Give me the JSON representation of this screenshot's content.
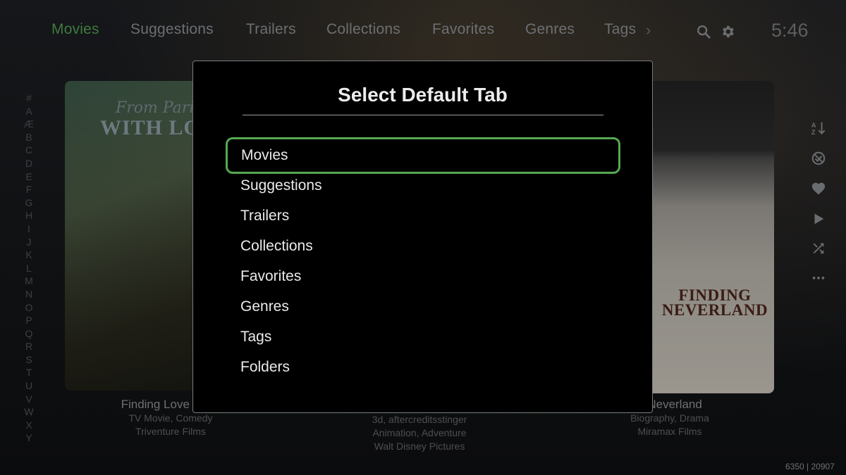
{
  "nav": {
    "tabs": [
      {
        "label": "Movies",
        "active": true
      },
      {
        "label": "Suggestions"
      },
      {
        "label": "Trailers"
      },
      {
        "label": "Collections"
      },
      {
        "label": "Favorites"
      },
      {
        "label": "Genres"
      },
      {
        "label": "Tags"
      }
    ],
    "more_icon": "chevron-right-icon",
    "search_icon": "search-icon",
    "settings_icon": "gear-icon",
    "clock": "5:46"
  },
  "alphabet": [
    "#",
    "A",
    "Æ",
    "B",
    "C",
    "D",
    "E",
    "F",
    "G",
    "H",
    "I",
    "J",
    "K",
    "L",
    "M",
    "N",
    "O",
    "P",
    "Q",
    "R",
    "S",
    "T",
    "U",
    "V",
    "W",
    "X",
    "Y"
  ],
  "posters": [
    {
      "poster_text_script": "From Paris",
      "poster_text": "WITH LO",
      "title": "Finding Love in Sa",
      "genres": "TV Movie, Comedy",
      "studio": "Triventure Films"
    },
    {
      "tags": "3d, aftercreditsstinger",
      "genres": "Animation, Adventure",
      "studio": "Walt Disney Pictures"
    },
    {
      "poster_text": "FINDING NEVERLAND",
      "title": "g Neverland",
      "genres": "Biography, Drama",
      "studio": "Miramax Films"
    }
  ],
  "side_actions": [
    "sort-az-icon",
    "watched-filter-icon",
    "heart-icon",
    "play-icon",
    "shuffle-icon",
    "more-icon"
  ],
  "counter": "6350 | 20907",
  "dialog": {
    "title": "Select Default Tab",
    "options": [
      "Movies",
      "Suggestions",
      "Trailers",
      "Collections",
      "Favorites",
      "Genres",
      "Tags",
      "Folders"
    ],
    "selected_index": 0
  },
  "colors": {
    "accent_green": "#55a852",
    "active_tab": "#3f7a3e",
    "dialog_bg": "#000000"
  }
}
